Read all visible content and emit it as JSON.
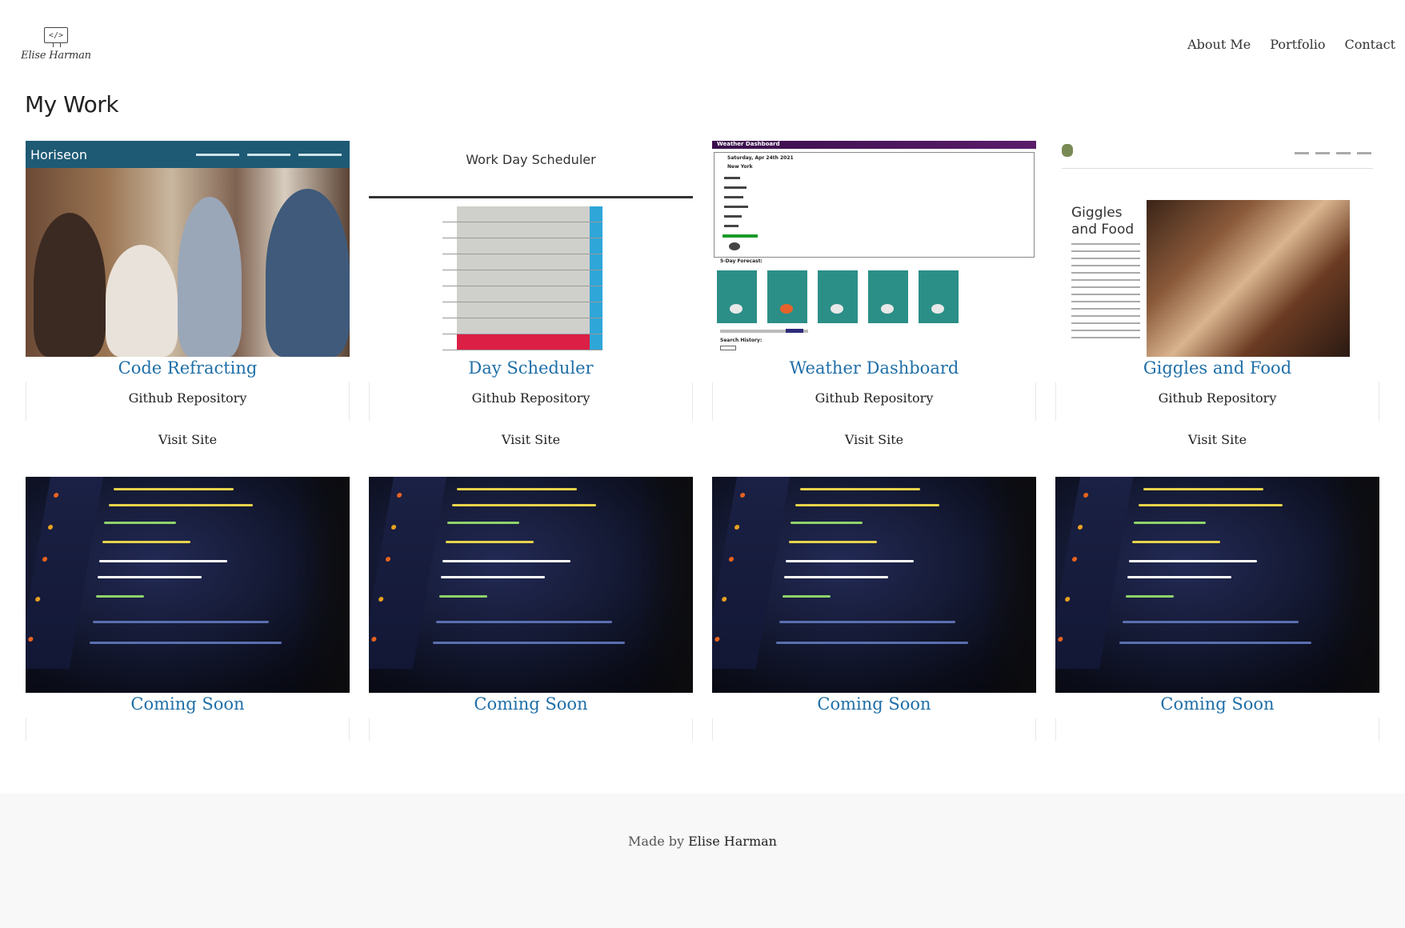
{
  "header": {
    "brand_name": "Elise Harman",
    "brand_icon": "code-monitor-icon",
    "nav": [
      {
        "label": "About Me"
      },
      {
        "label": "Portfolio"
      },
      {
        "label": "Contact"
      }
    ]
  },
  "page_title": "My Work",
  "projects": [
    {
      "title": "Code Refracting",
      "repo_label": "Github Repository",
      "visit_label": "Visit Site",
      "thumb": "horiseon-screenshot",
      "thumb_text": {
        "logo": "Horiseon"
      }
    },
    {
      "title": "Day Scheduler",
      "repo_label": "Github Repository",
      "visit_label": "Visit Site",
      "thumb": "day-scheduler-screenshot",
      "thumb_text": {
        "title": "Work Day Scheduler"
      }
    },
    {
      "title": "Weather Dashboard",
      "repo_label": "Github Repository",
      "visit_label": "Visit Site",
      "thumb": "weather-dashboard-screenshot",
      "thumb_text": {
        "header": "Weather Dashboard",
        "date": "Saturday, Apr 24th 2021",
        "city": "New York",
        "forecast": "5-Day Forecast:",
        "history": "Search History:"
      }
    },
    {
      "title": "Giggles and Food",
      "repo_label": "Github Repository",
      "visit_label": "Visit Site",
      "thumb": "giggles-and-food-screenshot",
      "thumb_text": {
        "heading": "Giggles and Food"
      }
    }
  ],
  "coming_soon": [
    {
      "title": "Coming Soon",
      "thumb": "code-editor-photo"
    },
    {
      "title": "Coming Soon",
      "thumb": "code-editor-photo"
    },
    {
      "title": "Coming Soon",
      "thumb": "code-editor-photo"
    },
    {
      "title": "Coming Soon",
      "thumb": "code-editor-photo"
    }
  ],
  "footer": {
    "prefix": "Made by",
    "author": "Elise Harman"
  },
  "colors": {
    "card_title": "#1f6fa8",
    "footer_bg": "#f8f8f8",
    "text": "#222222"
  }
}
